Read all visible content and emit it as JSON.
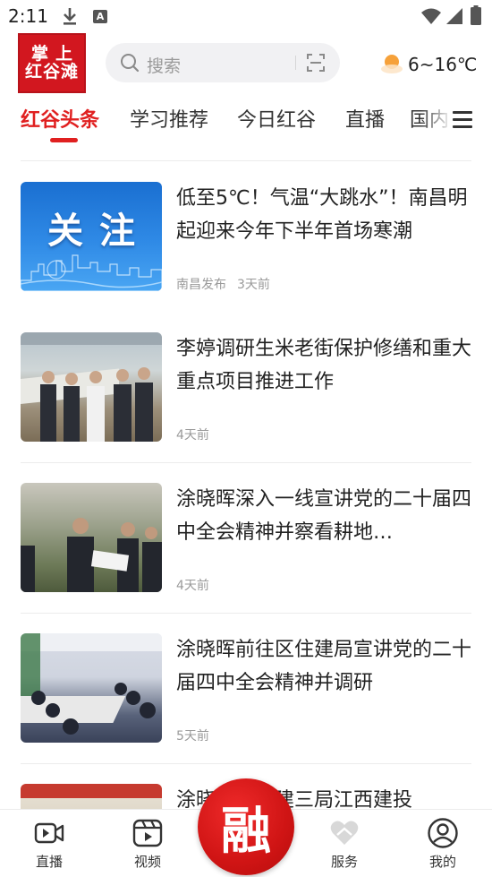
{
  "status_bar": {
    "time": "2:11",
    "notification_badge": "A"
  },
  "header": {
    "logo_line1": "掌上",
    "logo_line2": "红谷滩",
    "search_placeholder": "搜索",
    "weather": "6~16℃"
  },
  "tabs": [
    {
      "label": "红谷头条",
      "active": true
    },
    {
      "label": "学习推荐",
      "active": false
    },
    {
      "label": "今日红谷",
      "active": false
    },
    {
      "label": "直播",
      "active": false
    },
    {
      "label": "国内",
      "active": false
    }
  ],
  "news": [
    {
      "title": "低至5℃！气温“大跳水”！南昌明起迎来今年下半年首场寒潮",
      "source": "南昌发布",
      "time": "3天前",
      "thumb_caption": "关注"
    },
    {
      "title": "李婷调研生米老街保护修缮和重大重点项目推进工作",
      "source": "",
      "time": "4天前"
    },
    {
      "title": "涂晓晖深入一线宣讲党的二十届四中全会精神并察看耕地…",
      "source": "",
      "time": "4天前"
    },
    {
      "title": "涂晓晖前往区住建局宣讲党的二十届四中全会精神并调研",
      "source": "",
      "time": "5天前"
    },
    {
      "title": "涂晓晖…中建三局江西建投",
      "source": "",
      "time": ""
    }
  ],
  "bottom_nav": {
    "items": [
      {
        "label": "直播",
        "icon": "live-video-icon"
      },
      {
        "label": "视频",
        "icon": "video-play-icon"
      },
      {
        "label": "服务",
        "icon": "heart-hands-icon"
      },
      {
        "label": "我的",
        "icon": "user-icon"
      }
    ],
    "center_label": "融"
  },
  "colors": {
    "accent": "#e02020",
    "logo_bg": "#d2171f"
  }
}
